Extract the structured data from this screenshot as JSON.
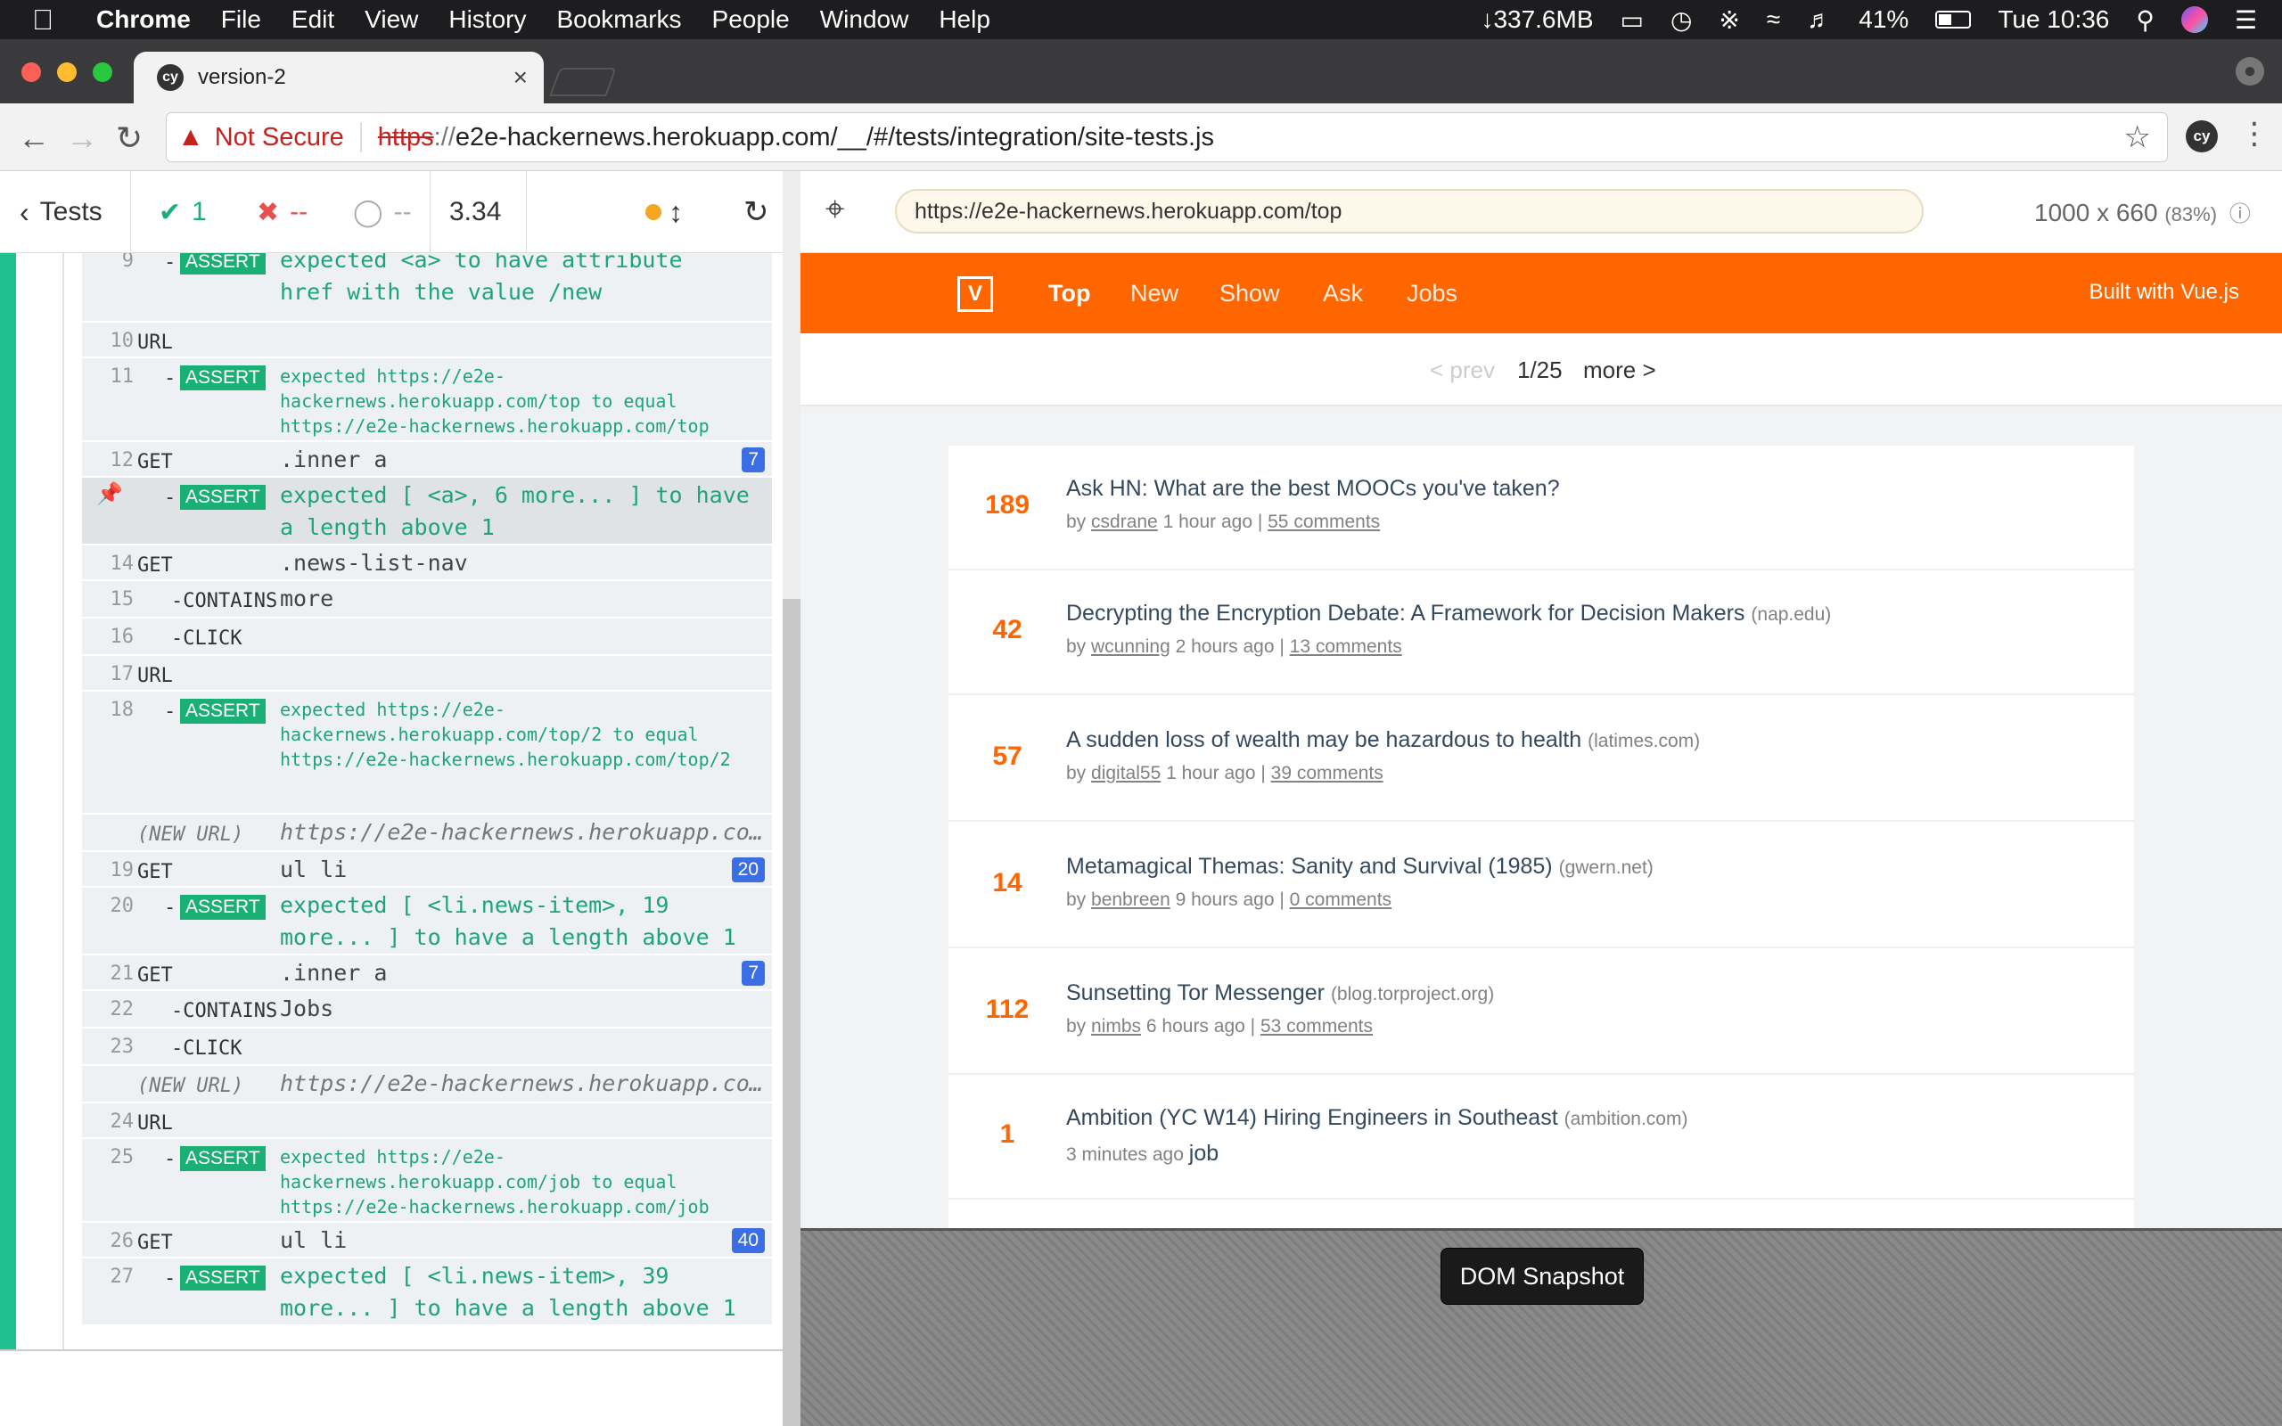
{
  "menubar": {
    "app": "Chrome",
    "items": [
      "File",
      "Edit",
      "View",
      "History",
      "Bookmarks",
      "People",
      "Window",
      "Help"
    ],
    "memory": "↓337.6MB",
    "battery": "41%",
    "clock": "Tue 10:36"
  },
  "tab": {
    "favicon": "cy",
    "title": "version-2",
    "close": "×"
  },
  "address": {
    "security_label": "Not Secure",
    "scheme": "https",
    "sep": "://",
    "rest": "e2e-hackernews.herokuapp.com/__/#/tests/integration/site-tests.js"
  },
  "extension_label": "cy",
  "reporter": {
    "tests_label": "Tests",
    "passed": "1",
    "failed": "--",
    "pending": "--",
    "duration": "3.34"
  },
  "commands": [
    {
      "num": "9",
      "type": "assert",
      "message": "expected <a> to have attribute",
      "message2": "href with the value /new"
    },
    {
      "num": "10",
      "name": "URL"
    },
    {
      "num": "11",
      "type": "assert",
      "small": true,
      "message": "expected https://e2e-hackernews.herokuapp.com/top to equal https://e2e-hackernews.herokuapp.com/top"
    },
    {
      "num": "12",
      "name": "GET",
      "message": ".inner a",
      "count": "7"
    },
    {
      "num": "",
      "type": "assert",
      "pinned": true,
      "message": "expected [ <a>, 6 more... ] to have",
      "message2": "a length above 1"
    },
    {
      "num": "14",
      "name": "GET",
      "message": ".news-list-nav"
    },
    {
      "num": "15",
      "name": "-CONTAINS",
      "message": "more"
    },
    {
      "num": "16",
      "name": "-CLICK"
    },
    {
      "num": "17",
      "name": "URL"
    },
    {
      "num": "18",
      "type": "assert",
      "small": true,
      "message": "expected https://e2e-hackernews.herokuapp.com/top/2 to equal https://e2e-hackernews.herokuapp.com/top/2"
    },
    {
      "num": "",
      "name": "(NEW URL)",
      "newurl": true,
      "message": "https://e2e-hackernews.herokuapp.co…"
    },
    {
      "num": "19",
      "name": "GET",
      "message": "ul li",
      "count": "20"
    },
    {
      "num": "20",
      "type": "assert",
      "message": "expected [ <li.news-item>, 19",
      "message2": "more... ] to have a length above 1"
    },
    {
      "num": "21",
      "name": "GET",
      "message": ".inner a",
      "count": "7"
    },
    {
      "num": "22",
      "name": "-CONTAINS",
      "message": "Jobs"
    },
    {
      "num": "23",
      "name": "-CLICK"
    },
    {
      "num": "",
      "name": "(NEW URL)",
      "newurl": true,
      "message": "https://e2e-hackernews.herokuapp.co…"
    },
    {
      "num": "24",
      "name": "URL"
    },
    {
      "num": "25",
      "type": "assert",
      "small": true,
      "message": "expected https://e2e-hackernews.herokuapp.com/job to equal https://e2e-hackernews.herokuapp.com/job"
    },
    {
      "num": "26",
      "name": "GET",
      "message": "ul li",
      "count": "40"
    },
    {
      "num": "27",
      "type": "assert",
      "message": "expected [ <li.news-item>, 39",
      "message2": "more... ] to have a length above 1"
    }
  ],
  "assert_label": "ASSERT",
  "aut": {
    "url": "https://e2e-hackernews.herokuapp.com/top",
    "size": "1000 x 660",
    "zoom": "(83%)"
  },
  "hn": {
    "logo": "V",
    "nav": [
      "Top",
      "New",
      "Show",
      "Ask",
      "Jobs"
    ],
    "built": "Built with Vue.js",
    "prev": "< prev",
    "page": "1/25",
    "more": "more >",
    "items": [
      {
        "score": "189",
        "title": "Ask HN: What are the best MOOCs you've taken?",
        "host": "",
        "by": "csdrane",
        "time": "1 hour ago",
        "comments": "55 comments"
      },
      {
        "score": "42",
        "title": "Decrypting the Encryption Debate: A Framework for Decision Makers",
        "host": "(nap.edu)",
        "by": "wcunning",
        "time": "2 hours ago",
        "comments": "13 comments"
      },
      {
        "score": "57",
        "title": "A sudden loss of wealth may be hazardous to health",
        "host": "(latimes.com)",
        "by": "digital55",
        "time": "1 hour ago",
        "comments": "39 comments"
      },
      {
        "score": "14",
        "title": "Metamagical Themas: Sanity and Survival (1985)",
        "host": "(gwern.net)",
        "by": "benbreen",
        "time": "9 hours ago",
        "comments": "0 comments"
      },
      {
        "score": "112",
        "title": "Sunsetting Tor Messenger",
        "host": "(blog.torproject.org)",
        "by": "nimbs",
        "time": "6 hours ago",
        "comments": "53 comments"
      },
      {
        "score": "1",
        "title": "Ambition (YC W14) Hiring Engineers in Southeast",
        "host": "(ambition.com)",
        "by": "",
        "time": "3 minutes ago",
        "comments": "",
        "job": "job"
      }
    ]
  },
  "snapshot_label": "DOM Snapshot",
  "colors": {
    "accent_orange": "#ff6600",
    "pass_green": "#1ab075",
    "count_blue": "#3b6ee5"
  }
}
